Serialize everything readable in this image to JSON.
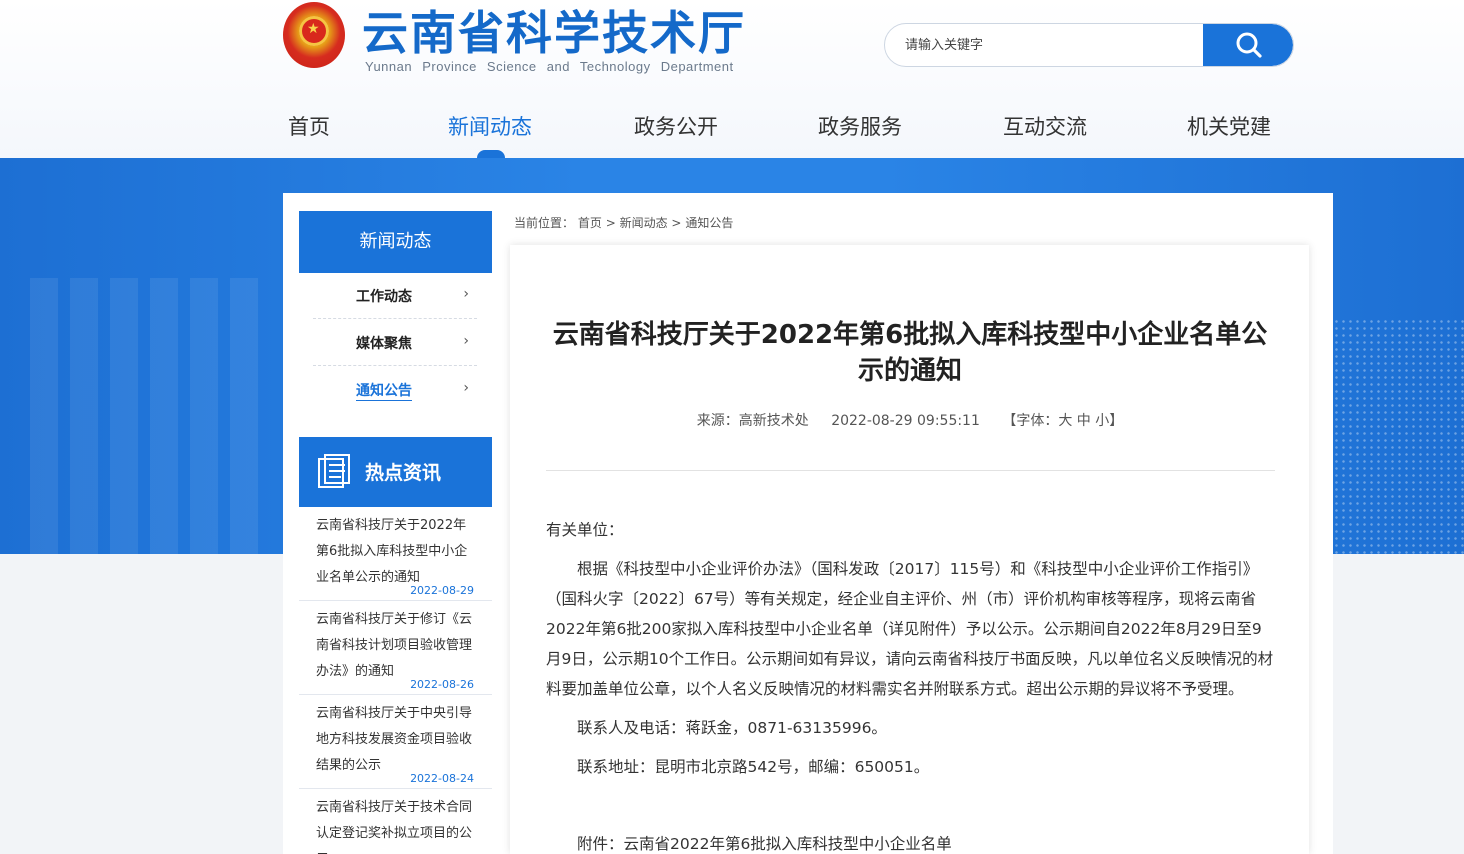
{
  "header": {
    "site_title": "云南省科学技术厅",
    "site_subtitle": "Yunnan Province Science and Technology Department",
    "emblem_icon": "national-emblem-icon",
    "search": {
      "placeholder": "请输入关键字",
      "value": ""
    }
  },
  "nav": {
    "items": [
      {
        "label": "首页"
      },
      {
        "label": "新闻动态",
        "active": true
      },
      {
        "label": "政务公开"
      },
      {
        "label": "政务服务"
      },
      {
        "label": "互动交流"
      },
      {
        "label": "机关党建"
      }
    ]
  },
  "sidebar": {
    "title": "新闻动态",
    "items": [
      {
        "label": "工作动态"
      },
      {
        "label": "媒体聚焦"
      },
      {
        "label": "通知公告",
        "active": true
      }
    ],
    "hot": {
      "title": "热点资讯",
      "items": [
        {
          "title": "云南省科技厅关于2022年第6批拟入库科技型中小企业名单公示的通知",
          "date": "2022-08-29"
        },
        {
          "title": "云南省科技厅关于修订《云南省科技计划项目验收管理办法》的通知",
          "date": "2022-08-26"
        },
        {
          "title": "云南省科技厅关于中央引导地方科技发展资金项目验收结果的公示",
          "date": "2022-08-24"
        },
        {
          "title": "云南省科技厅关于技术合同认定登记奖补拟立项目的公示",
          "date": ""
        }
      ]
    }
  },
  "breadcrumb": {
    "prefix": "当前位置：",
    "items": [
      "首页",
      "新闻动态",
      "通知公告"
    ],
    "separator": ">"
  },
  "article": {
    "title": "云南省科技厅关于2022年第6批拟入库科技型中小企业名单公示的通知",
    "source": "来源：高新技术处",
    "datetime": "2022-08-29 09:55:11",
    "font_size_label": "【字体：大 中 小】",
    "salutation": "有关单位：",
    "paragraph": "根据《科技型中小企业评价办法》（国科发政〔2017〕115号）和《科技型中小企业评价工作指引》（国科火字〔2022〕67号）等有关规定，经企业自主评价、州（市）评价机构审核等程序，现将云南省2022年第6批200家拟入库科技型中小企业名单（详见附件）予以公示。公示期间自2022年8月29日至9月9日，公示期10个工作日。公示期间如有异议，请向云南省科技厅书面反映，凡以单位名义反映情况的材料要加盖单位公章，以个人名义反映情况的材料需实名并附联系方式。超出公示期的异议将不予受理。",
    "contact": "联系人及电话：蒋跃金，0871-63135996。",
    "address": "联系地址：昆明市北京路542号，邮编：650051。",
    "attachment": "附件：云南省2022年第6批拟入库科技型中小企业名单"
  },
  "colors": {
    "primary": "#1a73d9",
    "band": "#2a84e6"
  }
}
